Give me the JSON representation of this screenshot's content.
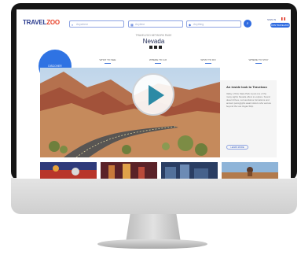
{
  "site": {
    "logo_part1": "TRAVEL",
    "logo_part2": "ZOO",
    "search_where": "Anywhere",
    "search_when": "Anytime",
    "search_what": "Anything",
    "search_button_icon": "search-icon",
    "sign_in": "SIGN IN",
    "join": "JOIN TRAVELZOO"
  },
  "page": {
    "subtitle": "TRAVELZOO NETWORK PAGE",
    "title": "Nevada"
  },
  "tabs": {
    "active": "DISCOVER",
    "items": [
      "WHAT TO SEE",
      "WHERE TO GO",
      "WHAT TO DO",
      "WHERE TO STAY"
    ]
  },
  "panel": {
    "title": "An inside look to Travelzoo",
    "body": "Valley of Fire State Park is just one of the many sights Nevada offers to explore. Scenic desert drives, red sandstone formations and ancient petroglyphs await visitors who venture beyond the Las Vegas Strip.",
    "button": "LEARN MORE"
  },
  "colors": {
    "accent": "#2f73e3",
    "logo_blue": "#2b3c8f",
    "logo_red": "#e8432b",
    "play": "#2c8aa5"
  }
}
